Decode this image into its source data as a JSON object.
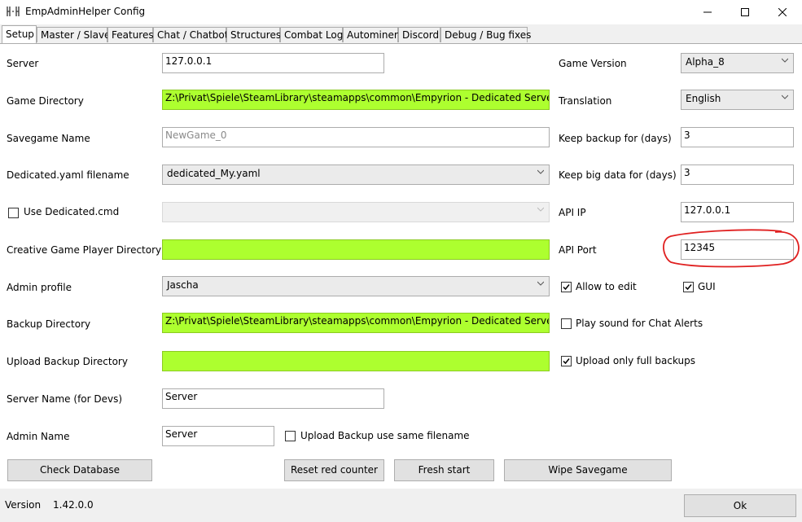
{
  "window": {
    "title": "EmpAdminHelper Config",
    "minimize_icon": "minimize-icon",
    "maximize_icon": "maximize-icon",
    "close_icon": "close-icon"
  },
  "tabs": [
    {
      "label": "Setup",
      "active": true
    },
    {
      "label": "Master / Slave"
    },
    {
      "label": "Features"
    },
    {
      "label": "Chat / Chatbot"
    },
    {
      "label": "Structures"
    },
    {
      "label": "Combat Log"
    },
    {
      "label": "Autominer"
    },
    {
      "label": "Discord"
    },
    {
      "label": "Debug / Bug fixes"
    }
  ],
  "left": {
    "server": {
      "label": "Server",
      "value": "127.0.0.1"
    },
    "game_directory": {
      "label": "Game Directory",
      "value": "Z:\\Privat\\Spiele\\SteamLibrary\\steamapps\\common\\Empyrion - Dedicated Server\\"
    },
    "savegame_name": {
      "label": "Savegame Name",
      "value": "NewGame_0"
    },
    "dedicated_yaml": {
      "label": "Dedicated.yaml filename",
      "value": "dedicated_My.yaml"
    },
    "use_dedicated_cmd": {
      "label": "Use Dedicated.cmd",
      "checked": false,
      "value": ""
    },
    "creative_dir": {
      "label": "Creative Game Player Directory",
      "value": ""
    },
    "admin_profile": {
      "label": "Admin profile",
      "value": "Jascha"
    },
    "backup_dir": {
      "label": "Backup Directory",
      "value": "Z:\\Privat\\Spiele\\SteamLibrary\\steamapps\\common\\Empyrion - Dedicated Server\\Backup\\"
    },
    "upload_backup_dir": {
      "label": "Upload Backup Directory",
      "value": ""
    },
    "server_name_devs": {
      "label": "Server Name (for Devs)",
      "value": "Server"
    },
    "admin_name": {
      "label": "Admin Name",
      "value": "Server"
    },
    "upload_same_filename": {
      "label": "Upload Backup use same filename",
      "checked": false
    }
  },
  "right": {
    "game_version": {
      "label": "Game Version",
      "value": "Alpha_8"
    },
    "translation": {
      "label": "Translation",
      "value": "English"
    },
    "keep_backup": {
      "label": "Keep backup for (days)",
      "value": "3"
    },
    "keep_big_data": {
      "label": "Keep big data for (days)",
      "value": "3"
    },
    "api_ip": {
      "label": "API IP",
      "value": "127.0.0.1"
    },
    "api_port": {
      "label": "API Port",
      "value": "12345"
    },
    "allow_to_edit": {
      "label": "Allow to edit",
      "checked": true
    },
    "gui": {
      "label": "GUI",
      "checked": true
    },
    "play_sound": {
      "label": "Play sound for Chat Alerts",
      "checked": false
    },
    "upload_full_backups": {
      "label": "Upload only full backups",
      "checked": true
    }
  },
  "buttons": {
    "check_database": "Check Database",
    "reset_red_counter": "Reset red counter",
    "fresh_start": "Fresh start",
    "wipe_savegame": "Wipe Savegame",
    "ok": "Ok"
  },
  "footer": {
    "version_label": "Version",
    "version_value": "1.42.0.0"
  },
  "colors": {
    "highlight_green": "#adff2f",
    "annotation_red": "#e02020"
  }
}
